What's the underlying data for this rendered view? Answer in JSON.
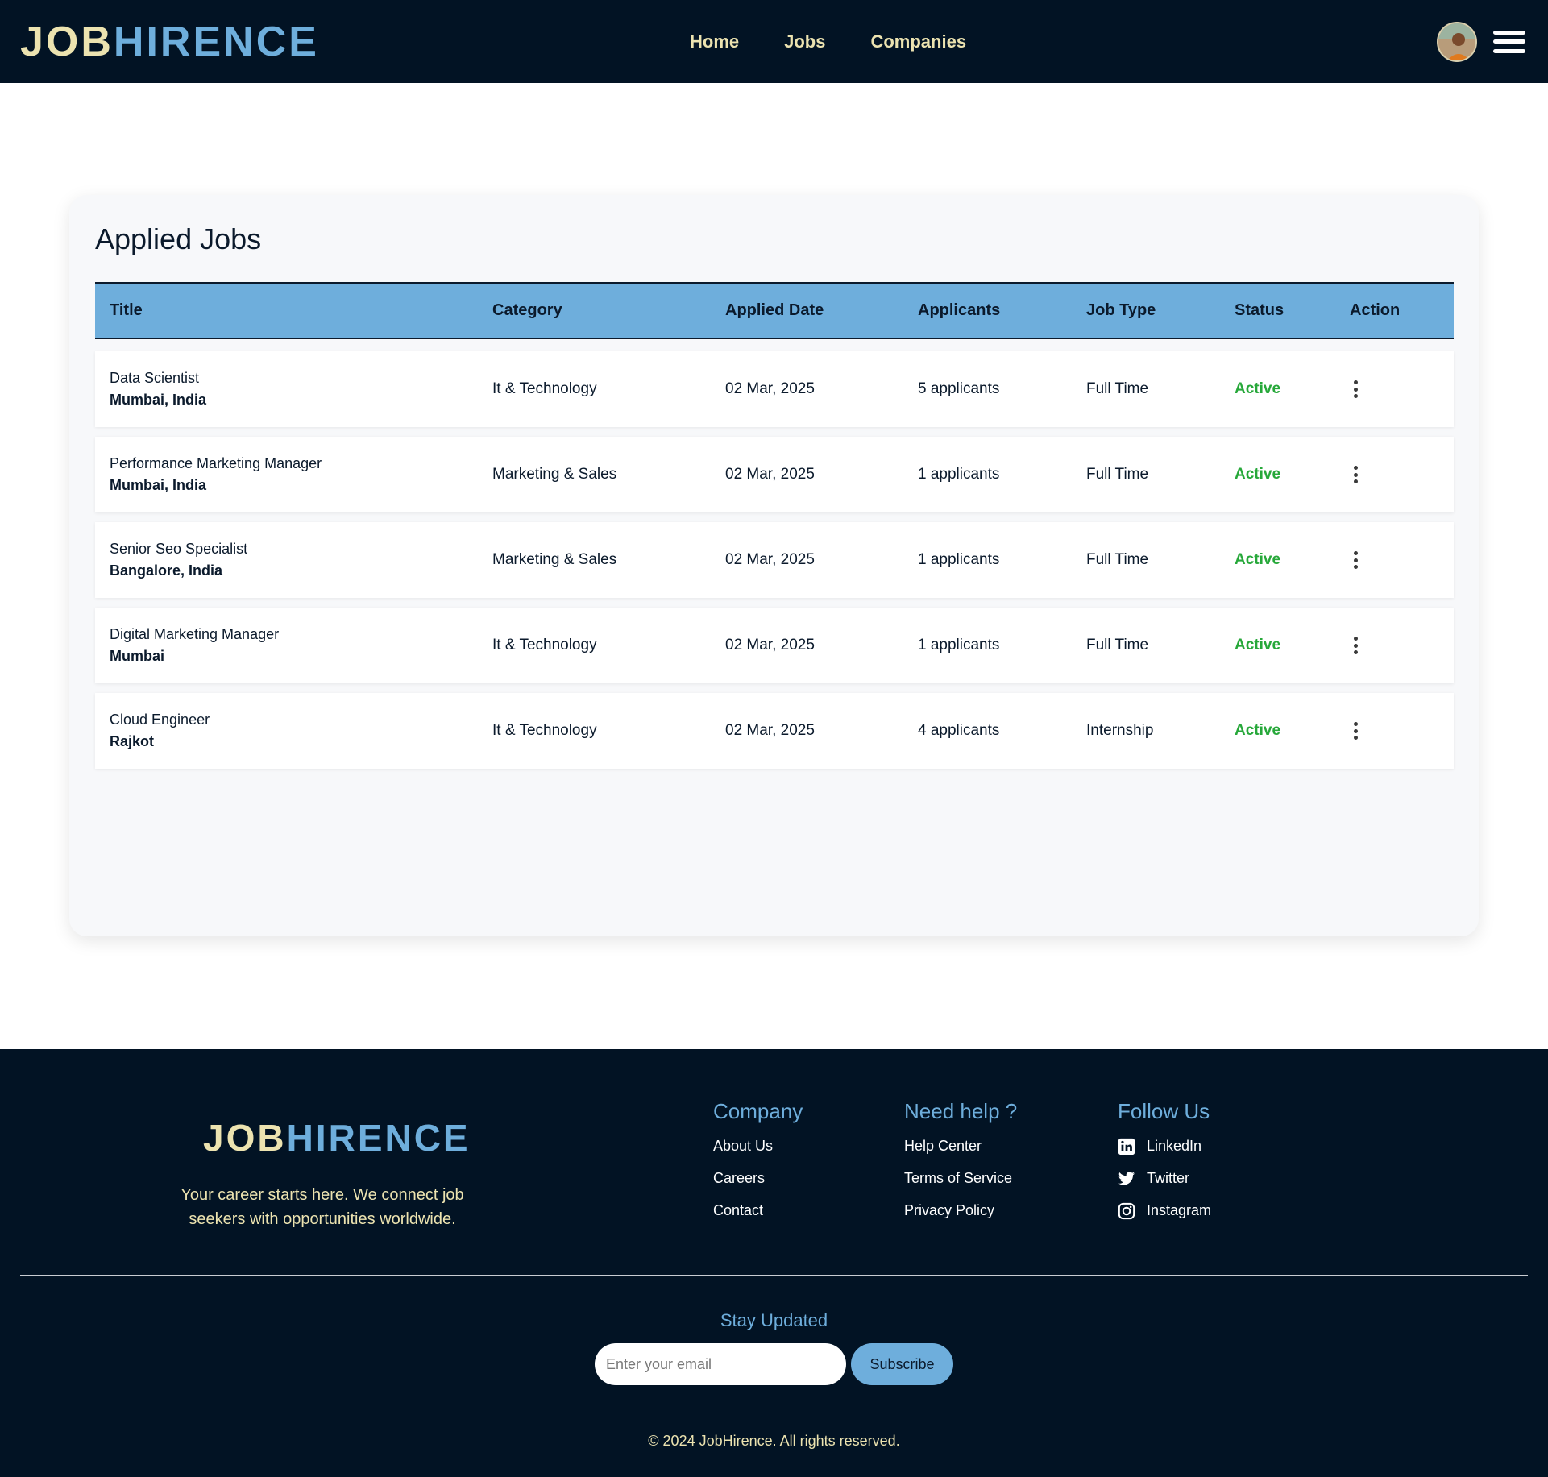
{
  "header": {
    "logo_part1": "JOB",
    "logo_part2": "HIRENCE",
    "nav": [
      "Home",
      "Jobs",
      "Companies"
    ]
  },
  "page": {
    "title": "Applied Jobs"
  },
  "table": {
    "columns": [
      "Title",
      "Category",
      "Applied Date",
      "Applicants",
      "Job Type",
      "Status",
      "Action"
    ],
    "rows": [
      {
        "title": "Data Scientist",
        "location": "Mumbai, India",
        "category": "It & Technology",
        "date": "02 Mar, 2025",
        "applicants": "5 applicants",
        "type": "Full Time",
        "status": "Active"
      },
      {
        "title": "Performance Marketing Manager",
        "location": "Mumbai, India",
        "category": "Marketing & Sales",
        "date": "02 Mar, 2025",
        "applicants": "1 applicants",
        "type": "Full Time",
        "status": "Active"
      },
      {
        "title": "Senior Seo Specialist",
        "location": "Bangalore, India",
        "category": "Marketing & Sales",
        "date": "02 Mar, 2025",
        "applicants": "1 applicants",
        "type": "Full Time",
        "status": "Active"
      },
      {
        "title": "Digital Marketing Manager",
        "location": "Mumbai",
        "category": "It & Technology",
        "date": "02 Mar, 2025",
        "applicants": "1 applicants",
        "type": "Full Time",
        "status": "Active"
      },
      {
        "title": "Cloud Engineer",
        "location": "Rajkot",
        "category": "It & Technology",
        "date": "02 Mar, 2025",
        "applicants": "4 applicants",
        "type": "Internship",
        "status": "Active"
      }
    ]
  },
  "footer": {
    "logo_part1": "JOB",
    "logo_part2": "HIRENCE",
    "tagline": "Your career starts here. We connect job seekers with opportunities worldwide.",
    "company": {
      "heading": "Company",
      "links": [
        "About Us",
        "Careers",
        "Contact"
      ]
    },
    "help": {
      "heading": "Need help ?",
      "links": [
        "Help Center",
        "Terms of Service",
        "Privacy Policy"
      ]
    },
    "follow": {
      "heading": "Follow Us",
      "links": [
        "LinkedIn",
        "Twitter",
        "Instagram"
      ]
    },
    "stay_updated": "Stay Updated",
    "email_placeholder": "Enter your email",
    "subscribe_label": "Subscribe",
    "copyright": "© 2024 JobHirence. All rights reserved."
  },
  "colors": {
    "navy": "#021324",
    "accent_blue": "#6eaedc",
    "cream": "#ece3b0",
    "status_green": "#27a83a"
  },
  "icons": [
    "avatar-image",
    "hamburger-menu-icon",
    "kebab-menu-icon",
    "linkedin-icon",
    "twitter-icon",
    "instagram-icon"
  ]
}
